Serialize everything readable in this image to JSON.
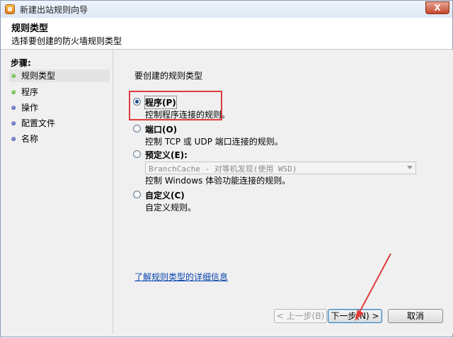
{
  "window": {
    "title": "新建出站规则向导",
    "close_label": "X"
  },
  "header": {
    "title": "规则类型",
    "subtitle": "选择要创建的防火墙规则类型"
  },
  "steps": {
    "title": "步骤:",
    "items": [
      {
        "label": "规则类型"
      },
      {
        "label": "程序"
      },
      {
        "label": "操作"
      },
      {
        "label": "配置文件"
      },
      {
        "label": "名称"
      }
    ]
  },
  "main": {
    "question": "要创建的规则类型",
    "options": [
      {
        "label": "程序(P)",
        "description": "控制程序连接的规则。",
        "checked": true
      },
      {
        "label": "端口(O)",
        "description": "控制 TCP 或 UDP 端口连接的规则。",
        "checked": false
      },
      {
        "label": "预定义(E):",
        "description": "控制 Windows 体验功能连接的规则。",
        "checked": false
      },
      {
        "label": "自定义(C)",
        "description": "自定义规则。",
        "checked": false
      }
    ],
    "predefined_select_value": "BranchCache - 对等机发现(使用 WSD)",
    "learn_more_link": "了解规则类型的详细信息"
  },
  "buttons": {
    "back": "< 上一步(B)",
    "next": "下一步(N) >",
    "cancel": "取消"
  },
  "colors": {
    "highlight_box": "#e03c3c",
    "accent": "#1c4d8f"
  }
}
